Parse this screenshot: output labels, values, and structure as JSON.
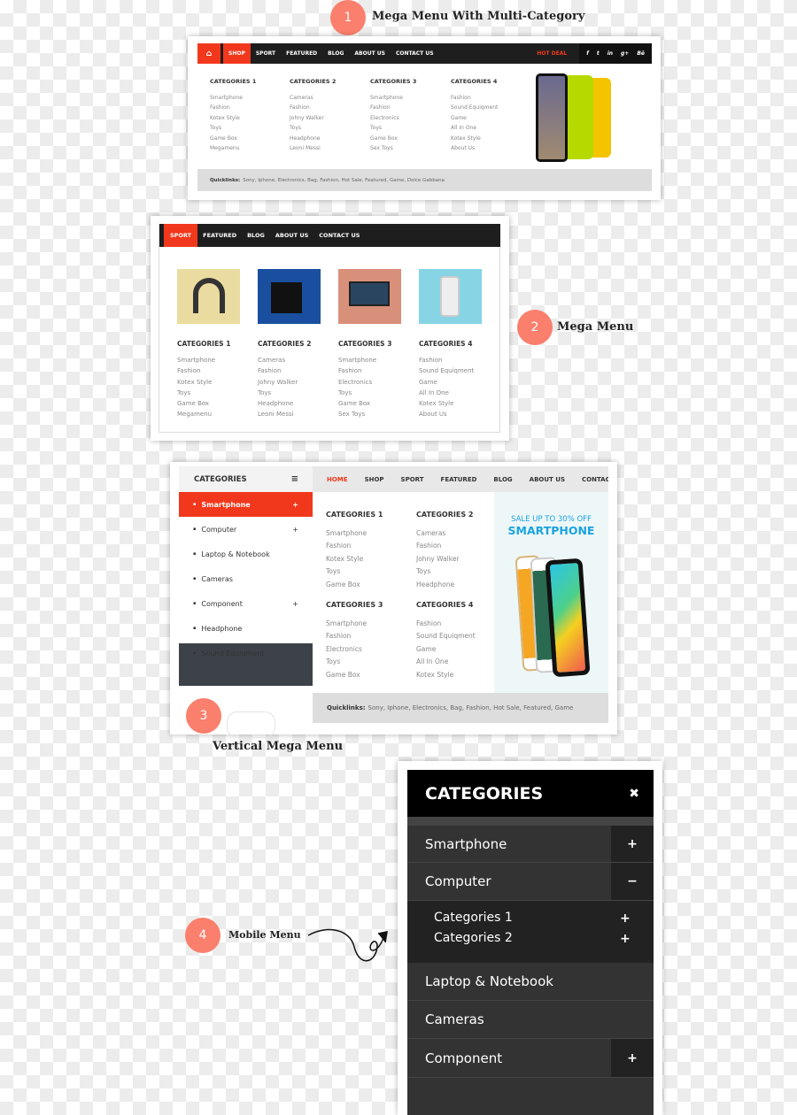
{
  "sections": [
    {
      "number": "1",
      "title": "Mega Menu With Multi-Category"
    },
    {
      "number": "2",
      "title": "Mega Menu"
    },
    {
      "number": "3",
      "title": "Vertical Mega Menu"
    },
    {
      "number": "4",
      "title": "Mobile Menu"
    }
  ],
  "menu1": {
    "nav": [
      "SHOP",
      "SPORT",
      "FEATURED",
      "BLOG",
      "ABOUT US",
      "CONTACT US"
    ],
    "hot_deal": "HOT DEAL",
    "social": [
      "f",
      "t",
      "in",
      "g+",
      "Bē"
    ],
    "columns": [
      {
        "title": "CATEGORIES 1",
        "items": [
          "Smartphone",
          "Fashion",
          "Kotex Style",
          "Toys",
          "Game Box",
          "Megamenu"
        ]
      },
      {
        "title": "CATEGORIES 2",
        "items": [
          "Cameras",
          "Fashion",
          "Johny Walker",
          "Toys",
          "Headphone",
          "Leoni Messi"
        ]
      },
      {
        "title": "CATEGORIES 3",
        "items": [
          "Smartphone",
          "Fashion",
          "Electronics",
          "Toys",
          "Game Box",
          "Sex Toys"
        ]
      },
      {
        "title": "CATEGORIES 4",
        "items": [
          "Fashion",
          "Sound Equiqment",
          "Game",
          "All In One",
          "Kotex Style",
          "About Us"
        ]
      }
    ],
    "quicklinks_label": "Quicklinks:",
    "quicklinks": "Sony, Iphone, Electronics, Bag, Fashion, Hot Sale, Featured, Game, Dolce Gabbana"
  },
  "menu2": {
    "nav": [
      "SPORT",
      "FEATURED",
      "BLOG",
      "ABOUT US",
      "CONTACT US"
    ],
    "columns": [
      {
        "title": "CATEGORIES 1",
        "items": [
          "Smartphone",
          "Fashion",
          "Kotex Style",
          "Toys",
          "Game Box",
          "Megamenu"
        ]
      },
      {
        "title": "CATEGORIES 2",
        "items": [
          "Cameras",
          "Fashion",
          "Johny Walker",
          "Toys",
          "Headphone",
          "Leoni Messi"
        ]
      },
      {
        "title": "CATEGORIES 3",
        "items": [
          "Smartphone",
          "Fashion",
          "Electronics",
          "Toys",
          "Game Box",
          "Sex Toys"
        ]
      },
      {
        "title": "CATEGORIES 4",
        "items": [
          "Fashion",
          "Sound Equiqment",
          "Game",
          "All In One",
          "Kotex Style",
          "About Us"
        ]
      }
    ]
  },
  "menu3": {
    "sidebar_title": "CATEGORIES",
    "sidebar": [
      {
        "label": "Smartphone",
        "plus": "+"
      },
      {
        "label": "Computer",
        "plus": "+"
      },
      {
        "label": "Laptop & Notebook",
        "plus": ""
      },
      {
        "label": "Cameras",
        "plus": ""
      },
      {
        "label": "Component",
        "plus": "+"
      },
      {
        "label": "Headphone",
        "plus": ""
      },
      {
        "label": "Sound Equiqment",
        "plus": ""
      }
    ],
    "nav": [
      "HOME",
      "SHOP",
      "SPORT",
      "FEATURED",
      "BLOG",
      "ABOUT US",
      "CONTACT"
    ],
    "columns": [
      {
        "title": "CATEGORIES 1",
        "items": [
          "Smartphone",
          "Fashion",
          "Kotex Style",
          "Toys",
          "Game Box"
        ]
      },
      {
        "title": "CATEGORIES 2",
        "items": [
          "Cameras",
          "Fashion",
          "Johny Walker",
          "Toys",
          "Headphone"
        ]
      },
      {
        "title": "CATEGORIES 3",
        "items": [
          "Smartphone",
          "Fashion",
          "Electronics",
          "Toys",
          "Game Box"
        ]
      },
      {
        "title": "CATEGORIES 4",
        "items": [
          "Fashion",
          "Sound Equiqment",
          "Game",
          "All In One",
          "Kotex Style"
        ]
      }
    ],
    "promo_sub": "SALE UP TO 30% OFF",
    "promo_title": "SMARTPHONE",
    "quicklinks_label": "Quicklinks:",
    "quicklinks": "Sony, Iphone, Electronics, Bag, Fashion, Hot Sale, Featured, Game"
  },
  "menu4": {
    "title": "CATEGORIES",
    "close": "✖",
    "items": [
      {
        "label": "Smartphone",
        "toggle": "+"
      },
      {
        "label": "Computer",
        "toggle": "−"
      }
    ],
    "sub": [
      {
        "label": "Categories 1",
        "toggle": "+"
      },
      {
        "label": "Categories 2",
        "toggle": "+"
      }
    ],
    "more": [
      {
        "label": "Laptop & Notebook",
        "toggle": ""
      },
      {
        "label": "Cameras",
        "toggle": ""
      },
      {
        "label": "Component",
        "toggle": "+"
      }
    ]
  },
  "colors": {
    "accent": "#f2381c",
    "badge": "#fa7f6c",
    "promo": "#1aa3e0"
  }
}
